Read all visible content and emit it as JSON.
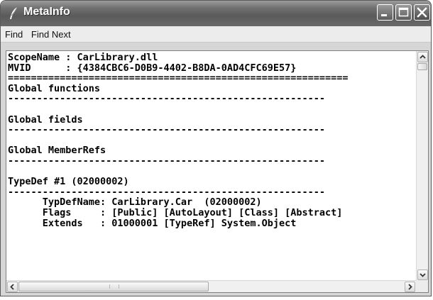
{
  "window": {
    "title": "MetaInfo",
    "app_icon": "quill-icon",
    "buttons": [
      "minimize-icon",
      "maximize-icon",
      "close-icon"
    ]
  },
  "menu": {
    "items": [
      {
        "label": "Find"
      },
      {
        "label": "Find Next"
      }
    ]
  },
  "content": {
    "lines": [
      "ScopeName : CarLibrary.dll",
      "MVID      : {4384CBC6-D0B9-4402-B8DA-0AD4CFC69E57}",
      "===========================================================",
      "Global functions",
      "-------------------------------------------------------",
      "",
      "Global fields",
      "-------------------------------------------------------",
      "",
      "Global MemberRefs",
      "-------------------------------------------------------",
      "",
      "TypeDef #1 (02000002)",
      "-------------------------------------------------------",
      "      TypDefName: CarLibrary.Car  (02000002)",
      "      Flags     : [Public] [AutoLayout] [Class] [Abstract]",
      "      Extends   : 01000001 [TypeRef] System.Object"
    ]
  },
  "scrollbars": {
    "vertical": {
      "icons": [
        "scroll-up-arrow-icon",
        "scroll-down-arrow-icon"
      ]
    },
    "horizontal": {
      "icons": [
        "scroll-left-arrow-icon",
        "scroll-right-arrow-icon"
      ]
    }
  },
  "colors": {
    "titlebar": "#6f6f6f",
    "menubar": "#ececec",
    "client_bg": "#ffffff",
    "text": "#000000"
  }
}
